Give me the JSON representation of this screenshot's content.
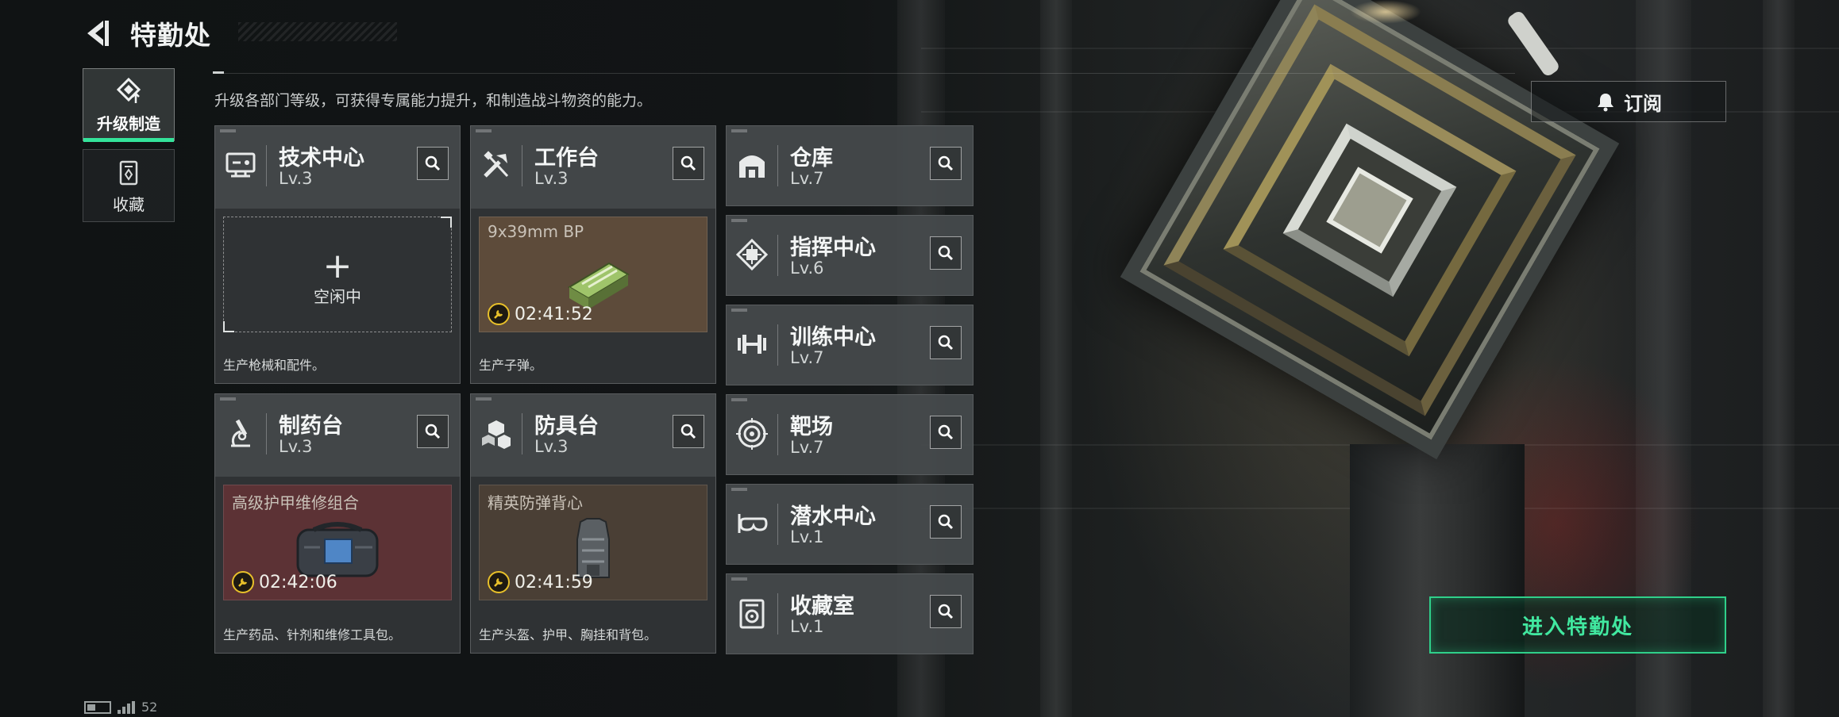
{
  "header": {
    "title": "特勤处"
  },
  "subtitle": "升级各部门等级，可获得专属能力提升，和制造战斗物资的能力。",
  "nav": [
    {
      "label": "升级制造",
      "icon": "upgrade-craft-icon",
      "active": true
    },
    {
      "label": "收藏",
      "icon": "collection-icon",
      "active": false
    }
  ],
  "subscribe": {
    "label": "订阅",
    "icon": "bell-icon"
  },
  "enter_button": {
    "label": "进入特勤处"
  },
  "status_bar": {
    "ping": "52"
  },
  "facilities": {
    "tech": {
      "name": "技术中心",
      "level": "Lv.3",
      "icon": "monitor-icon",
      "slot": {
        "state": "空闲中"
      },
      "desc": "生产枪械和配件。"
    },
    "workbench": {
      "name": "工作台",
      "level": "Lv.3",
      "icon": "tools-icon",
      "slot": {
        "item": "9x39mm BP",
        "timer": "02:41:52"
      },
      "desc": "生产子弹。"
    },
    "pharmacy": {
      "name": "制药台",
      "level": "Lv.3",
      "icon": "microscope-icon",
      "slot": {
        "item": "高级护甲维修组合",
        "timer": "02:42:06"
      },
      "desc": "生产药品、针剂和维修工具包。"
    },
    "armor": {
      "name": "防具台",
      "level": "Lv.3",
      "icon": "cubes-icon",
      "slot": {
        "item": "精英防弹背心",
        "timer": "02:41:59"
      },
      "desc": "生产头盔、护甲、胸挂和背包。"
    },
    "warehouse": {
      "name": "仓库",
      "level": "Lv.7",
      "icon": "warehouse-icon"
    },
    "command": {
      "name": "指挥中心",
      "level": "Lv.6",
      "icon": "chip-icon"
    },
    "training": {
      "name": "训练中心",
      "level": "Lv.7",
      "icon": "dumbbell-icon"
    },
    "range": {
      "name": "靶场",
      "level": "Lv.7",
      "icon": "target-icon"
    },
    "diving": {
      "name": "潜水中心",
      "level": "Lv.1",
      "icon": "diving-mask-icon"
    },
    "vault": {
      "name": "收藏室",
      "level": "Lv.1",
      "icon": "vault-icon"
    }
  }
}
